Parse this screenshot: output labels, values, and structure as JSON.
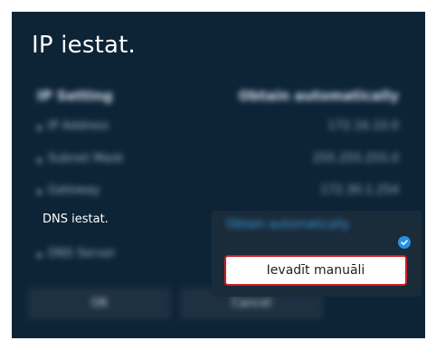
{
  "title": "IP iestat.",
  "ip_settings": {
    "header": {
      "label": "IP Setting",
      "value": "Obtain automatically"
    },
    "rows": [
      {
        "label": "IP Address",
        "value": "172.16.10.0"
      },
      {
        "label": "Subnet Mask",
        "value": "255.255.255.0"
      },
      {
        "label": "Gateway",
        "value": "172.30.1.254"
      }
    ],
    "dns_server": {
      "label": "DNS Server"
    }
  },
  "dns": {
    "label": "DNS iestat.",
    "selected_option": "Obtain automatically",
    "manual_option": "Ievadīt manuāli"
  },
  "buttons": {
    "ok": "OK",
    "cancel": "Cancel"
  },
  "colors": {
    "background": "#0d2437",
    "accent": "#2a8fe0",
    "focus": "#d11b26"
  },
  "icons": {
    "bullet": "bullet-icon",
    "check": "check-icon"
  }
}
